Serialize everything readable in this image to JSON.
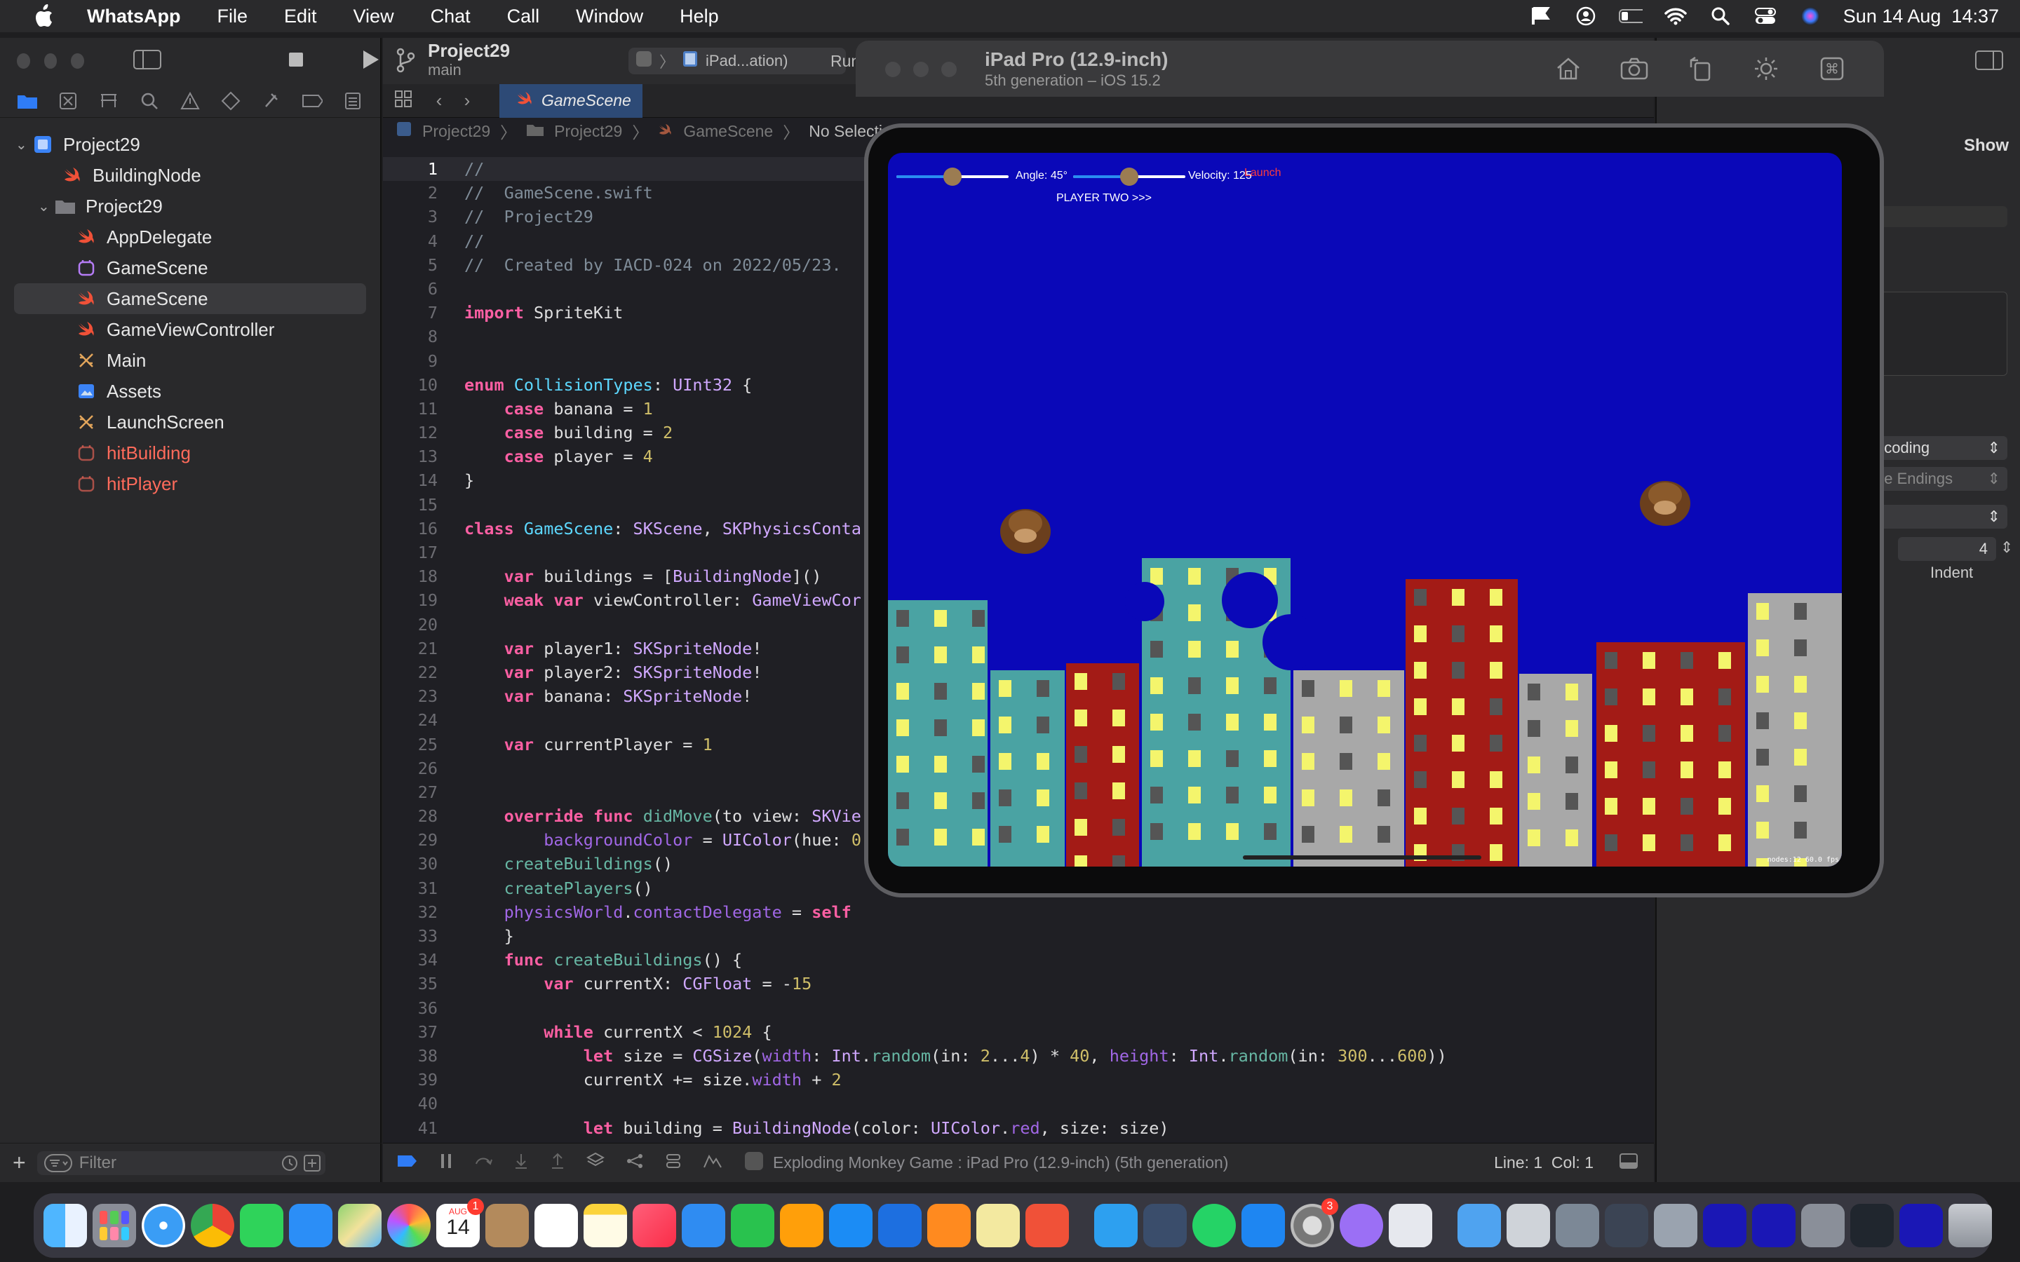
{
  "menubar": {
    "app_name": "WhatsApp",
    "menus": [
      "File",
      "Edit",
      "View",
      "Chat",
      "Call",
      "Window",
      "Help"
    ],
    "clock": "Sun 14 Aug  14:37"
  },
  "navigator": {
    "filter_placeholder": "Filter",
    "tree": [
      {
        "label": "Project29",
        "kind": "project",
        "level": 0,
        "expanded": true
      },
      {
        "label": "BuildingNode",
        "kind": "swift",
        "level": 1
      },
      {
        "label": "Project29",
        "kind": "folder",
        "level": 1,
        "expanded": true
      },
      {
        "label": "AppDelegate",
        "kind": "swift",
        "level": 2
      },
      {
        "label": "GameScene",
        "kind": "sks",
        "level": 2
      },
      {
        "label": "GameScene",
        "kind": "swift",
        "level": 2,
        "selected": true
      },
      {
        "label": "GameViewController",
        "kind": "swift",
        "level": 2
      },
      {
        "label": "Main",
        "kind": "storyboard",
        "level": 2
      },
      {
        "label": "Assets",
        "kind": "assets",
        "level": 2
      },
      {
        "label": "LaunchScreen",
        "kind": "storyboard",
        "level": 2
      },
      {
        "label": "hitBuilding",
        "kind": "missing",
        "level": 2
      },
      {
        "label": "hitPlayer",
        "kind": "missing",
        "level": 2
      }
    ]
  },
  "editor": {
    "project_name": "Project29",
    "branch": "main",
    "scheme_label": "iPad...ation)",
    "run_label": "Run",
    "active_tab": "GameScene",
    "jumpbar": [
      "Project29",
      "Project29",
      "GameScene",
      "No Selection"
    ],
    "status": "Exploding Monkey Game : iPad Pro (12.9-inch) (5th generation)",
    "line_col": "Line: 1  Col: 1",
    "code_lines": [
      "//",
      "//  GameScene.swift",
      "//  Project29",
      "//",
      "//  Created by IACD-024 on 2022/05/23.",
      "",
      "import SpriteKit",
      "",
      "",
      "enum CollisionTypes: UInt32 {",
      "    case banana = 1",
      "    case building = 2",
      "    case player = 4",
      "}",
      "",
      "class GameScene: SKScene, SKPhysicsConta",
      "",
      "    var buildings = [BuildingNode]()",
      "    weak var viewController: GameViewCor",
      "",
      "    var player1: SKSpriteNode!",
      "    var player2: SKSpriteNode!",
      "    var banana: SKSpriteNode!",
      "",
      "    var currentPlayer = 1",
      "",
      "",
      "    override func didMove(to view: SKVie",
      "        backgroundColor = UIColor(hue: 0",
      "    createBuildings()",
      "    createPlayers()",
      "    physicsWorld.contactDelegate = self",
      "    }",
      "    func createBuildings() {",
      "        var currentX: CGFloat = -15",
      "",
      "        while currentX < 1024 {",
      "            let size = CGSize(width: Int.random(in: 2...4) * 40, height: Int.random(in: 300...600))",
      "            currentX += size.width + 2",
      "",
      "            let building = BuildingNode(color: UIColor.red, size: size)"
    ]
  },
  "inspector": {
    "show_label": "Show",
    "text_encoding": "ncoding",
    "line_endings": "ne Endings",
    "indent_value": "4",
    "indent_label": "Indent"
  },
  "simulator": {
    "device": "iPad Pro (12.9-inch)",
    "os": "5th generation – iOS 15.2"
  },
  "game": {
    "angle_label": "Angle: 45°",
    "velocity_label": "Velocity: 125",
    "launch_label": "Launch",
    "player_label": "PLAYER TWO >>>",
    "angle_fraction": 0.5,
    "velocity_fraction": 0.5,
    "fps_label": "nodes:12  60.0 fps",
    "colors": {
      "sky": "#0a08b8",
      "teal": "#4aa3a3",
      "red": "#a31b16",
      "gray": "#a8a8a8",
      "window_lit": "#f4f56c",
      "window_dark": "#555555"
    }
  },
  "dock": {
    "calendar_day": "14",
    "calendar_month": "AUG",
    "calendar_badge": "1",
    "settings_badge": "3"
  }
}
